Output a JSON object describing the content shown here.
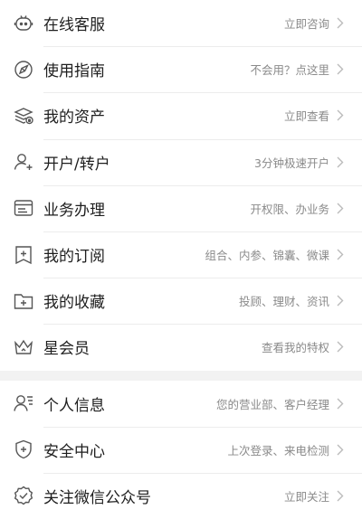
{
  "group1": [
    {
      "label": "在线客服",
      "hint": "立即咨询",
      "icon": "customer-service-icon"
    },
    {
      "label": "使用指南",
      "hint": "不会用？点这里",
      "icon": "compass-guide-icon"
    },
    {
      "label": "我的资产",
      "hint": "立即查看",
      "icon": "assets-stack-icon"
    },
    {
      "label": "开户/转户",
      "hint": "3分钟极速开户",
      "icon": "add-user-icon"
    },
    {
      "label": "业务办理",
      "hint": "开权限、办业务",
      "icon": "business-window-icon"
    },
    {
      "label": "我的订阅",
      "hint": "组合、内参、锦囊、微课",
      "icon": "subscription-icon"
    },
    {
      "label": "我的收藏",
      "hint": "投顾、理财、资讯",
      "icon": "folder-add-icon"
    },
    {
      "label": "星会员",
      "hint": "查看我的特权",
      "icon": "crown-icon"
    }
  ],
  "group2": [
    {
      "label": "个人信息",
      "hint": "您的营业部、客户经理",
      "icon": "personal-info-icon"
    },
    {
      "label": "安全中心",
      "hint": "上次登录、来电检测",
      "icon": "shield-icon"
    },
    {
      "label": "关注微信公众号",
      "hint": "立即关注",
      "icon": "wechat-check-icon"
    }
  ],
  "colors": {
    "icon_stroke": "#555555",
    "hint_text": "#8a8a8a",
    "chevron": "#bbbbbb",
    "divider": "#ececec",
    "section_gap": "#f2f2f2"
  }
}
